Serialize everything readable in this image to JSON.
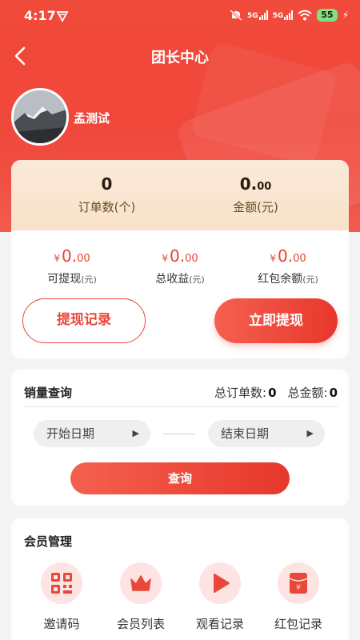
{
  "status_bar": {
    "time": "4:17",
    "network_1": "5G",
    "network_2": "5G",
    "battery": "55"
  },
  "header": {
    "title": "团长中心"
  },
  "profile": {
    "username": "孟测试"
  },
  "summary": {
    "order_count": "0",
    "order_count_label": "订单数(个)",
    "amount_int": "0.",
    "amount_dec": "00",
    "amount_label": "金额(元)"
  },
  "balances": [
    {
      "currency": "¥",
      "int": "0.",
      "dec": "00",
      "label": "可提现",
      "unit": "(元)"
    },
    {
      "currency": "¥",
      "int": "0.",
      "dec": "00",
      "label": "总收益",
      "unit": "(元)"
    },
    {
      "currency": "¥",
      "int": "0.",
      "dec": "00",
      "label": "红包余额",
      "unit": "(元)"
    }
  ],
  "actions": {
    "withdraw_history": "提现记录",
    "withdraw_now": "立即提现"
  },
  "sales_query": {
    "title": "销量查询",
    "total_orders_label": "总订单数:",
    "total_orders_value": "0",
    "total_amount_label": "总金额:",
    "total_amount_value": "0",
    "start_date_placeholder": "开始日期",
    "end_date_placeholder": "结束日期",
    "query_button": "查询"
  },
  "members": {
    "title": "会员管理",
    "items": [
      {
        "label": "邀请码",
        "icon": "qr-code-icon"
      },
      {
        "label": "会员列表",
        "icon": "crown-icon"
      },
      {
        "label": "观看记录",
        "icon": "play-icon"
      },
      {
        "label": "红包记录",
        "icon": "red-envelope-icon"
      }
    ]
  },
  "colors": {
    "brand_red": "#e9473a",
    "icon_bg": "#fde3e1",
    "summary_bg": "#fbe9d9"
  }
}
